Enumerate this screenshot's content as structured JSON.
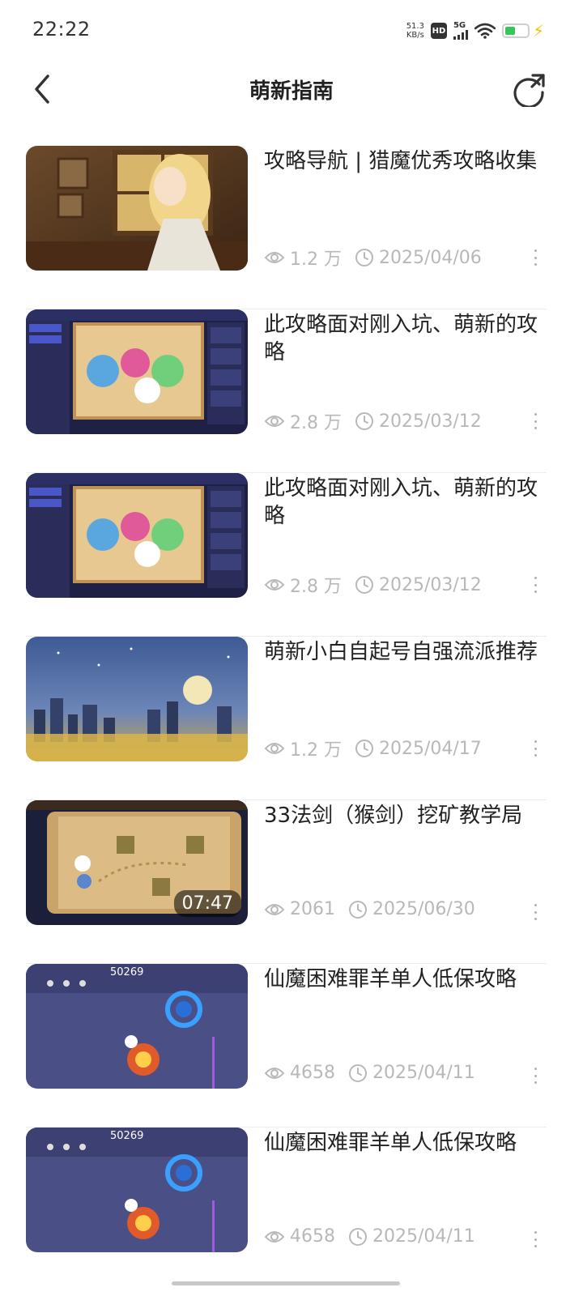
{
  "status_bar": {
    "time": "22:22",
    "net_speed_value": "51.3",
    "net_speed_unit": "KB/s",
    "hd_label": "HD",
    "network_label": "5G",
    "battery_color": "#35c759"
  },
  "header": {
    "title": "萌新指南",
    "back_icon": "chevron-left-icon",
    "refresh_icon": "refresh-icon"
  },
  "articles": [
    {
      "title": "攻略导航 | 猎魔优秀攻略收集",
      "views": "1.2 万",
      "date": "2025/04/06",
      "thumb": "girl-writing",
      "duration": ""
    },
    {
      "title": "此攻略面对刚入坑、萌新的攻略",
      "views": "2.8 万",
      "date": "2025/03/12",
      "thumb": "game-event",
      "duration": ""
    },
    {
      "title": "此攻略面对刚入坑、萌新的攻略",
      "views": "2.8 万",
      "date": "2025/03/12",
      "thumb": "game-event",
      "duration": ""
    },
    {
      "title": "萌新小白自起号自强流派推荐",
      "views": "1.2 万",
      "date": "2025/04/17",
      "thumb": "night-city",
      "duration": ""
    },
    {
      "title": "33法剑（猴剑）挖矿教学局",
      "views": "2061",
      "date": "2025/06/30",
      "thumb": "map-scroll",
      "duration": "07:47"
    },
    {
      "title": "仙魔困难罪羊单人低保攻略",
      "views": "4658",
      "date": "2025/04/11",
      "thumb": "battle",
      "duration": ""
    },
    {
      "title": "仙魔困难罪羊单人低保攻略",
      "views": "4658",
      "date": "2025/04/11",
      "thumb": "battle",
      "duration": ""
    }
  ],
  "thumb_text": {
    "battle_score": "50269"
  },
  "colors": {
    "text_primary": "#222222",
    "text_meta": "#b8b8b8",
    "divider": "#ececec"
  }
}
